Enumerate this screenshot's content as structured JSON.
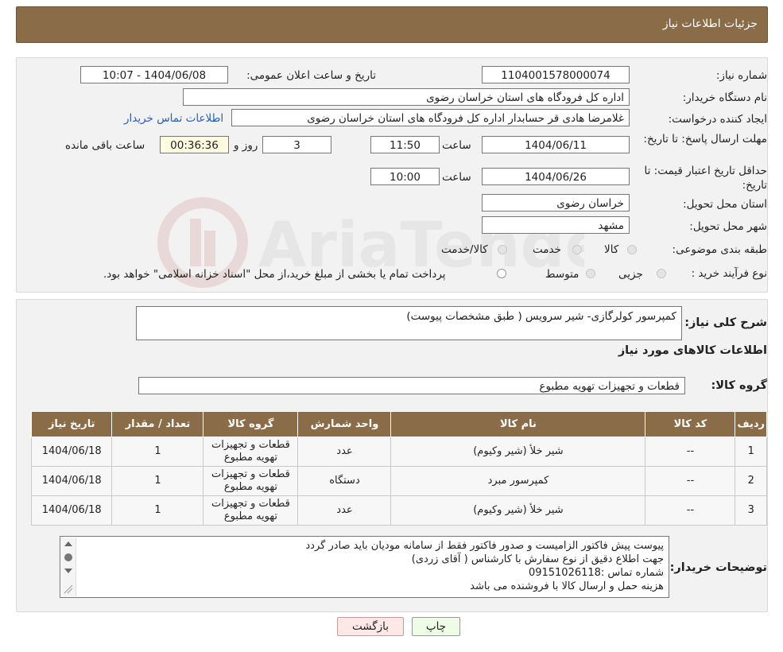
{
  "header": {
    "title": "جزئیات اطلاعات نیاز"
  },
  "info": {
    "need_number_label": "شماره نیاز:",
    "need_number": "1104001578000074",
    "announce_label": "تاریخ و ساعت اعلان عمومی:",
    "announce_value": "1404/06/08 - 10:07",
    "buyer_org_label": "نام دستگاه خریدار:",
    "buyer_org": "اداره کل فرودگاه های استان خراسان رضوی",
    "requester_label": "ایجاد کننده درخواست:",
    "requester": "غلامرضا هادی قر حسابدار اداره کل فرودگاه های استان خراسان رضوی",
    "contact_link": "اطلاعات تماس خریدار",
    "deadline_label": "مهلت ارسال پاسخ: تا تاریخ:",
    "deadline_date": "1404/06/11",
    "time_label": "ساعت",
    "deadline_time": "11:50",
    "days_value": "3",
    "days_label": "روز و",
    "remaining_time": "00:36:36",
    "remaining_label": "ساعت باقی مانده",
    "validity_label": "حداقل تاریخ اعتبار قیمت: تا تاریخ:",
    "validity_date": "1404/06/26",
    "validity_time": "10:00",
    "province_label": "استان محل تحویل:",
    "province": "خراسان رضوی",
    "city_label": "شهر محل تحویل:",
    "city": "مشهد",
    "category_label": "طبقه بندی موضوعی:",
    "category_options": [
      "کالا",
      "خدمت",
      "کالا/خدمت"
    ],
    "purchase_type_label": "نوع فرآیند خرید :",
    "purchase_options": [
      "جزیی",
      "متوسط"
    ],
    "purchase_note": "پرداخت تمام یا بخشی از مبلغ خرید،از محل \"اسناد خزانه اسلامی\" خواهد بود."
  },
  "summary": {
    "label": "شرح کلی نیاز:",
    "value": "کمپرسور کولرگازی- شیر سرویس ( طبق مشخصات پیوست)",
    "goods_info_title": "اطلاعات کالاهای مورد نیاز",
    "group_label": "گروه کالا:",
    "group_value": "قطعات و تجهیزات تهویه مطبوع"
  },
  "table": {
    "headers": [
      "ردیف",
      "کد کالا",
      "نام کالا",
      "واحد شمارش",
      "گروه کالا",
      "تعداد / مقدار",
      "تاریخ نیاز"
    ],
    "rows": [
      [
        "1",
        "--",
        "شیر خلأ (شیر وکیوم)",
        "عدد",
        "قطعات و تجهیزات تهویه مطبوع",
        "1",
        "1404/06/18"
      ],
      [
        "2",
        "--",
        "کمپرسور مبرد",
        "دستگاه",
        "قطعات و تجهیزات تهویه مطبوع",
        "1",
        "1404/06/18"
      ],
      [
        "3",
        "--",
        "شیر خلأ (شیر وکیوم)",
        "عدد",
        "قطعات و تجهیزات تهویه مطبوع",
        "1",
        "1404/06/18"
      ]
    ]
  },
  "buyer_notes": {
    "label": "توضیحات خریدار:",
    "lines": [
      "پیوست پیش فاکتور الزامیست و صدور فاکتور فقط از سامانه مودیان باید صادر گردد",
      "جهت اطلاع دقیق از نوع سفارش با کارشناس  ( آقای زردی)",
      "شماره تماس :09151026118",
      "هزینه حمل و ارسال کالا با فروشنده می باشد"
    ]
  },
  "buttons": {
    "print": "چاپ",
    "back": "بازگشت"
  },
  "watermark_text": "AriaTender.neT"
}
